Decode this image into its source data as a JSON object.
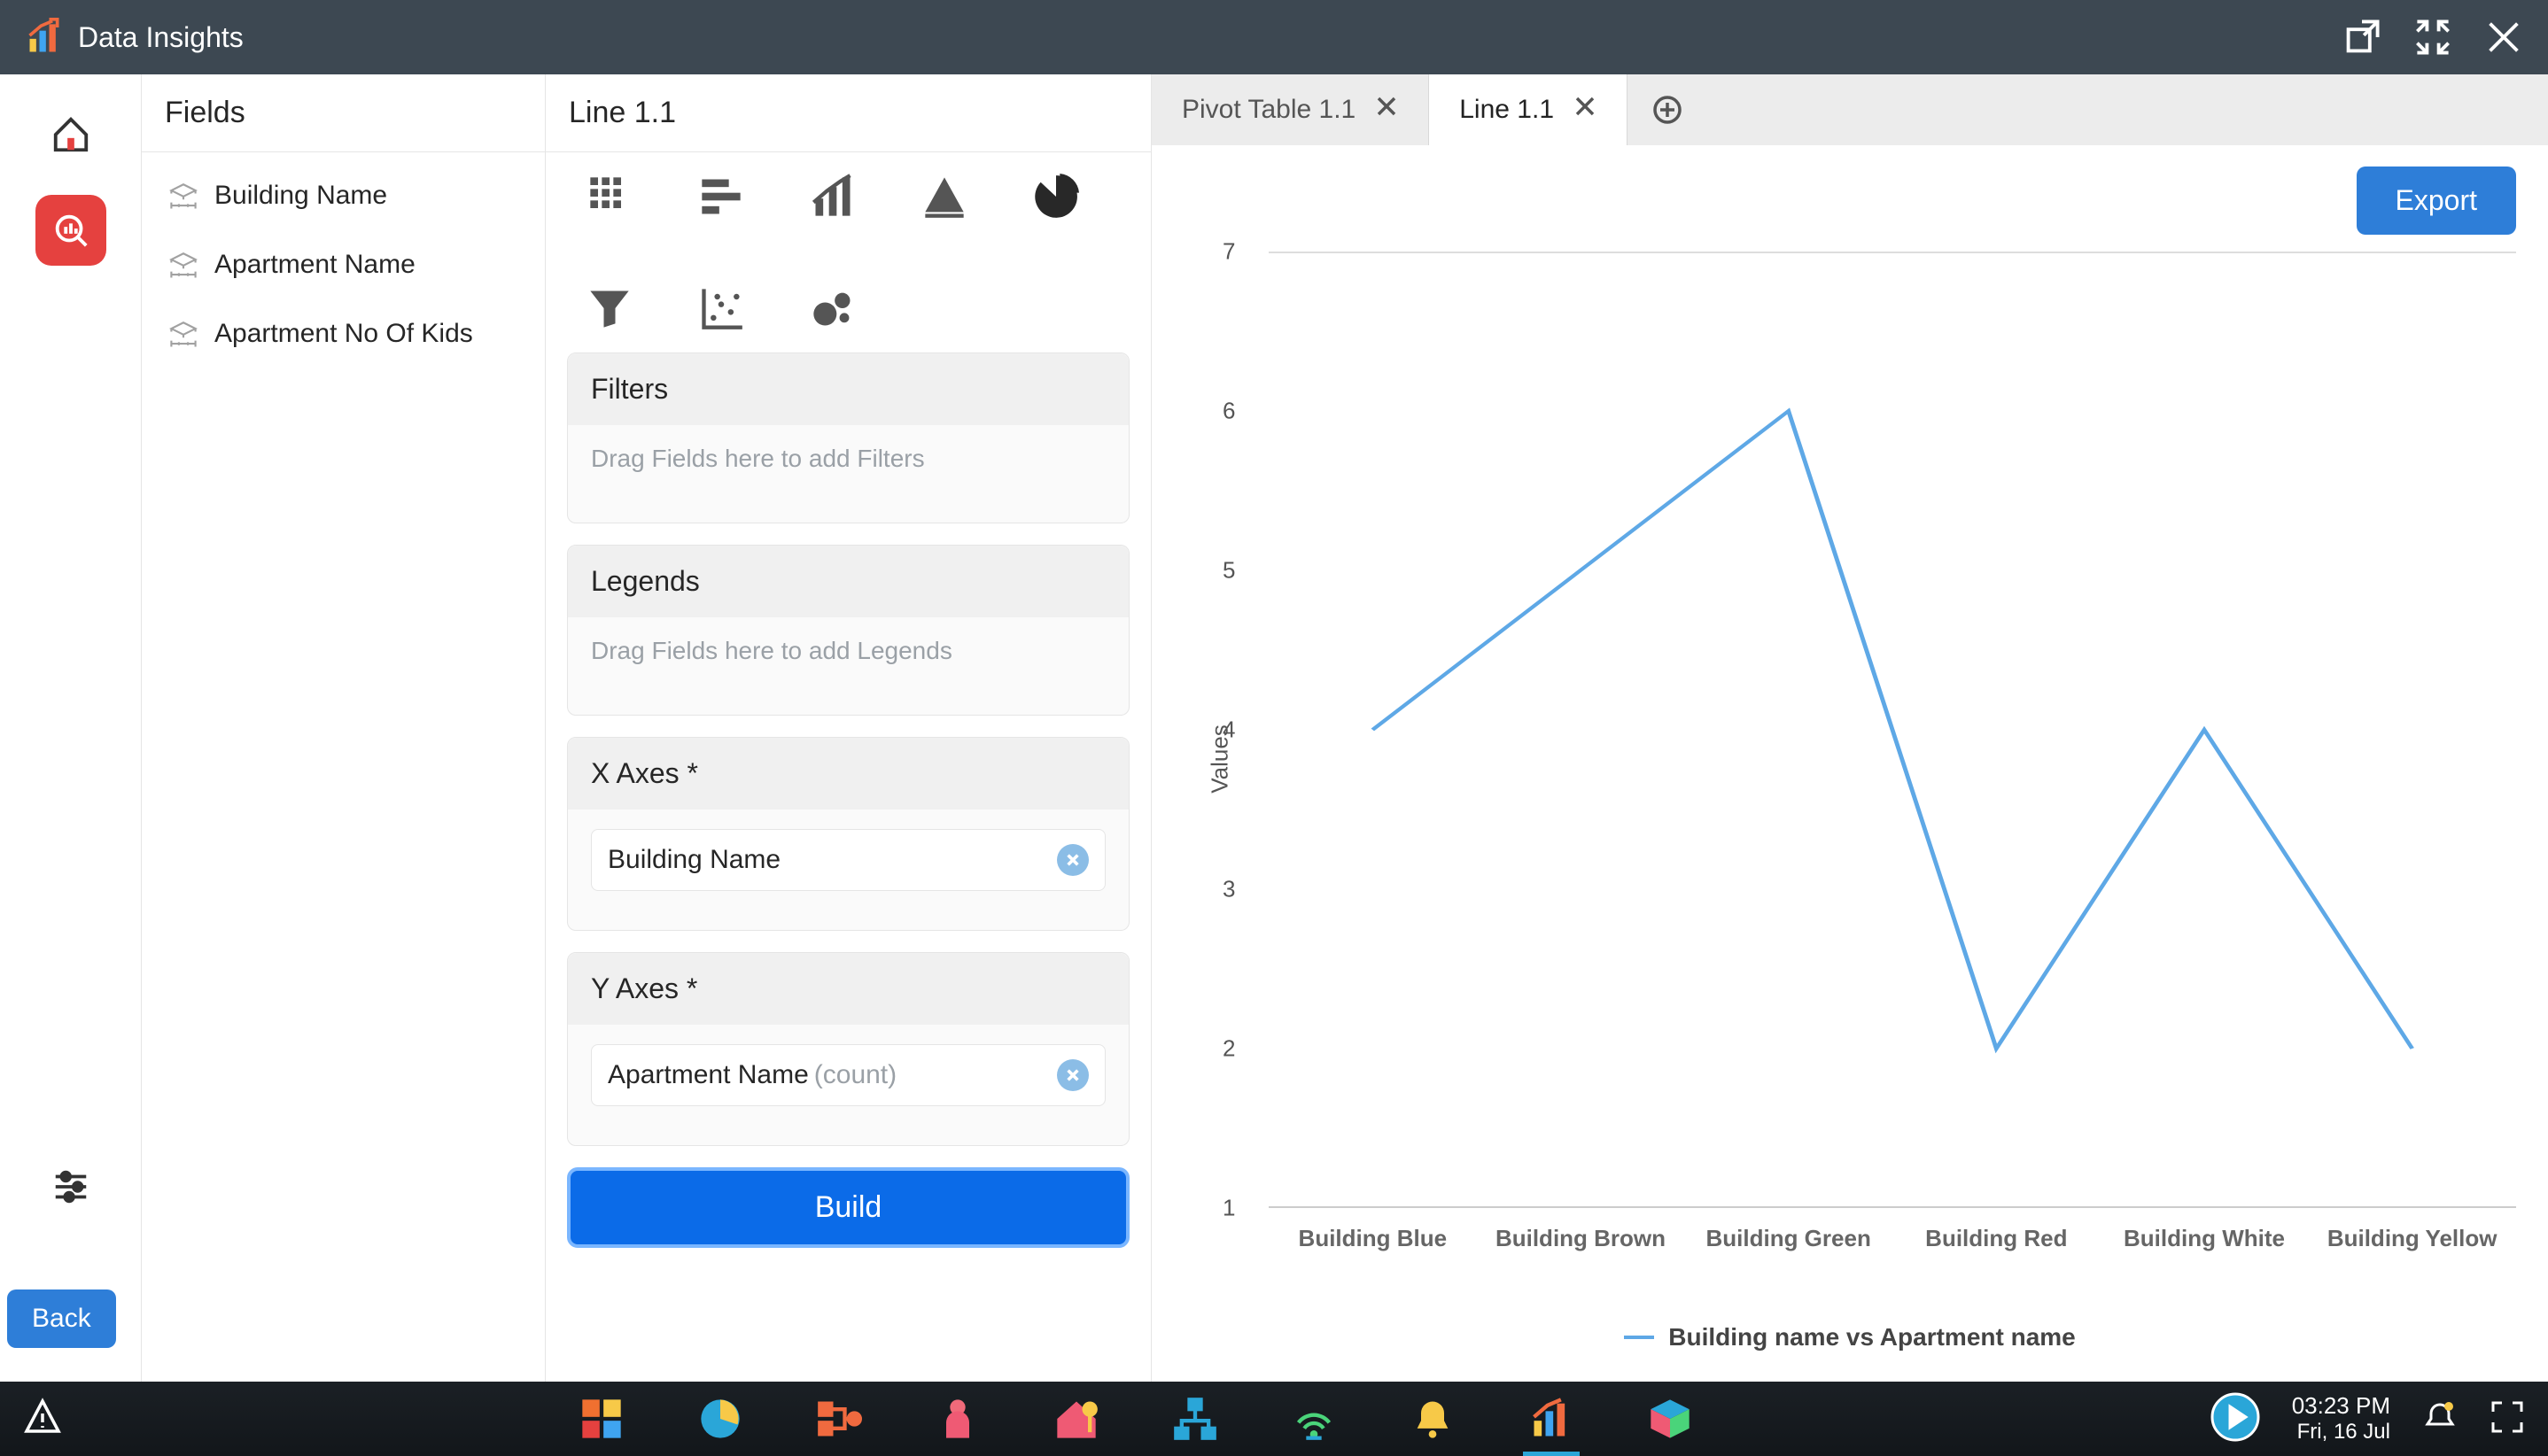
{
  "title": "Data Insights",
  "sidenav": {
    "back_label": "Back"
  },
  "fields": {
    "heading": "Fields",
    "items": [
      "Building Name",
      "Apartment Name",
      "Apartment No Of Kids"
    ]
  },
  "config": {
    "heading": "Line 1.1",
    "chart_types": [
      "pivot",
      "bar",
      "line",
      "area",
      "pie",
      "funnel",
      "scatter",
      "bubble"
    ],
    "selected_chart_type": "pie",
    "filters": {
      "title": "Filters",
      "placeholder": "Drag Fields here to add Filters"
    },
    "legends": {
      "title": "Legends",
      "placeholder": "Drag Fields here to add Legends"
    },
    "xaxes": {
      "title": "X Axes *",
      "chip": {
        "label": "Building Name"
      }
    },
    "yaxes": {
      "title": "Y Axes *",
      "chip": {
        "label": "Apartment Name",
        "agg": "(count)"
      }
    },
    "build_label": "Build"
  },
  "tabs": {
    "items": [
      {
        "label": "Pivot Table 1.1",
        "active": false
      },
      {
        "label": "Line 1.1",
        "active": true
      }
    ]
  },
  "export_label": "Export",
  "chart_data": {
    "type": "line",
    "categories": [
      "Building Blue",
      "Building Brown",
      "Building Green",
      "Building Red",
      "Building White",
      "Building Yellow"
    ],
    "series": [
      {
        "name": "Building name vs Apartment name",
        "values": [
          4,
          5,
          6,
          2,
          4,
          2
        ]
      }
    ],
    "ylabel": "Values",
    "xlabel": "",
    "ylim": [
      1,
      7
    ],
    "grid": false
  },
  "taskbar": {
    "time": "03:23 PM",
    "date": "Fri, 16 Jul"
  }
}
